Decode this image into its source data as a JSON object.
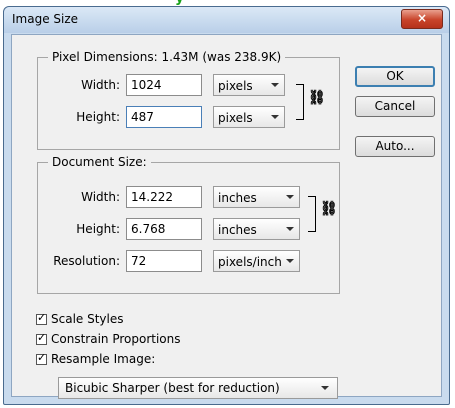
{
  "window": {
    "title": "Image Size",
    "close_glyph": "×"
  },
  "pixel_dimensions": {
    "legend": "Pixel Dimensions:  1.43M (was 238.9K)",
    "width": {
      "label": "Width:",
      "value": "1024",
      "unit": "pixels"
    },
    "height": {
      "label": "Height:",
      "value": "487",
      "unit": "pixels"
    },
    "link_icon": "chain-link"
  },
  "document_size": {
    "legend": "Document Size:",
    "width": {
      "label": "Width:",
      "value": "14.222",
      "unit": "inches"
    },
    "height": {
      "label": "Height:",
      "value": "6.768",
      "unit": "inches"
    },
    "resolution": {
      "label": "Resolution:",
      "value": "72",
      "unit": "pixels/inch"
    },
    "link_icon": "chain-link"
  },
  "buttons": {
    "ok": "OK",
    "cancel": "Cancel",
    "auto": "Auto..."
  },
  "options": {
    "scale_styles": {
      "label": "Scale Styles",
      "checked": true
    },
    "constrain_proportions": {
      "label": "Constrain Proportions",
      "checked": true
    },
    "resample_image": {
      "label": "Resample Image:",
      "checked": true
    }
  },
  "resample_method": "Bicubic Sharper (best for reduction)",
  "colors": {
    "accent": "#3c7fb1",
    "close_button": "#c8432a",
    "frame": "#c9dbee"
  }
}
